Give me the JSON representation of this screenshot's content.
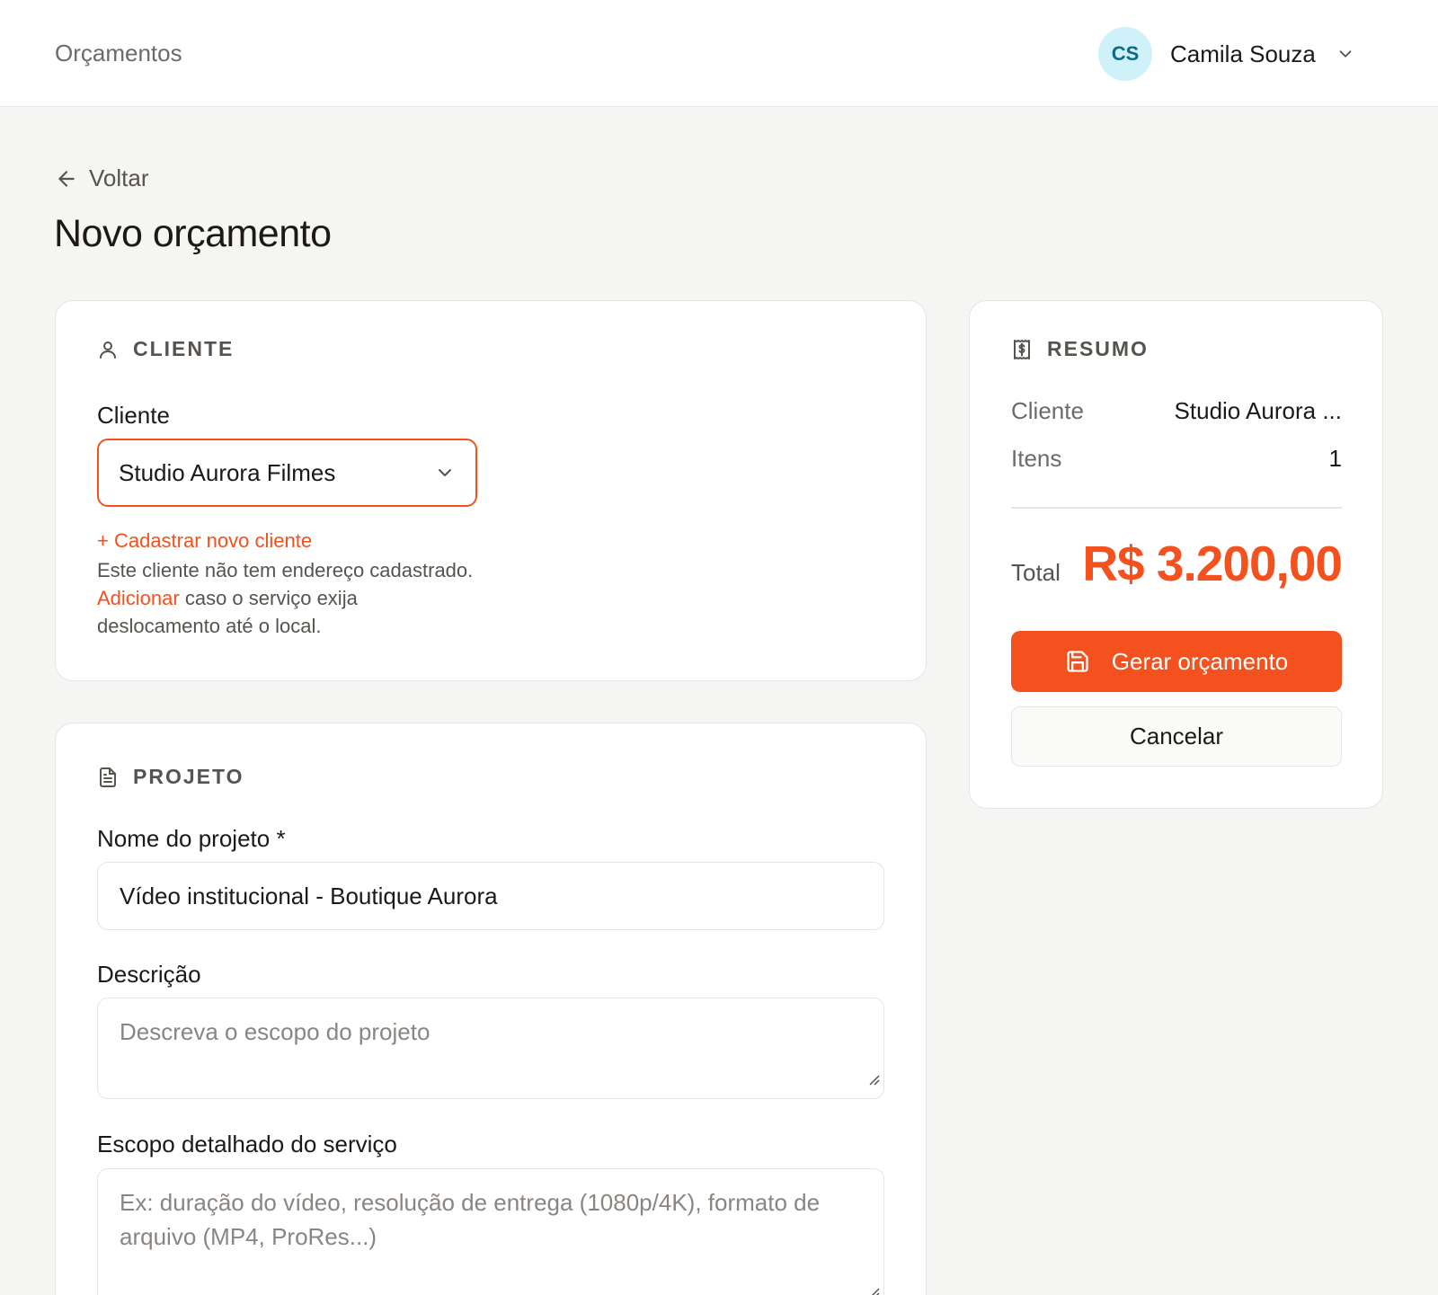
{
  "header": {
    "app_title": "Orçamentos",
    "user": {
      "initials": "CS",
      "name": "Camila Souza"
    }
  },
  "nav": {
    "back_label": "Voltar"
  },
  "page": {
    "title": "Novo orçamento"
  },
  "client_section": {
    "title": "CLIENTE",
    "client_label": "Cliente",
    "client_value": "Studio Aurora Filmes",
    "new_client_link": "+ Cadastrar novo cliente",
    "help_text_1": "Este cliente não tem endereço cadastrado.",
    "help_link": "Adicionar",
    "help_text_2": "caso o serviço exija deslocamento até o local."
  },
  "project_section": {
    "title": "PROJETO",
    "name_label": "Nome do projeto *",
    "name_value": "Vídeo institucional - Boutique Aurora",
    "description_label": "Descrição",
    "description_placeholder": "Descreva o escopo do projeto",
    "scope_label": "Escopo detalhado do serviço",
    "scope_placeholder": "Ex: duração do vídeo, resolução de entrega (1080p/4K), formato de arquivo (MP4, ProRes...)"
  },
  "summary": {
    "title": "RESUMO",
    "client_key": "Cliente",
    "client_value": "Studio Aurora ...",
    "items_key": "Itens",
    "items_value": "1",
    "total_label": "Total",
    "total_value": "R$ 3.200,00",
    "generate_label": "Gerar orçamento",
    "cancel_label": "Cancelar"
  },
  "colors": {
    "accent": "#f4511e",
    "avatar_bg": "#cff2fa",
    "avatar_text": "#0e6b85"
  }
}
